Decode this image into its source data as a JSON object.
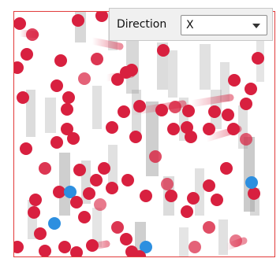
{
  "controls": {
    "direction_label": "Direction",
    "direction_value": "X"
  },
  "colors": {
    "frame": "#e23b3b",
    "particle_red": "#d8203f",
    "particle_blue": "#2d8fe0",
    "bar_gray": "#a8a8a8",
    "panel_bg": "#f0f0f0"
  },
  "icons": {
    "dropdown": "chevron-down-icon"
  }
}
